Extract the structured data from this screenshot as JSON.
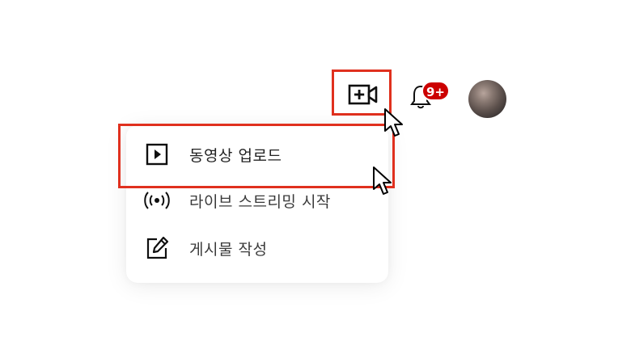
{
  "header": {
    "create_icon": "video-plus-icon",
    "bell_icon": "bell-icon",
    "notification_badge": "9+",
    "avatar": "user-avatar"
  },
  "create_menu": {
    "items": [
      {
        "label": "동영상 업로드",
        "icon": "play-square-icon"
      },
      {
        "label": "라이브 스트리밍 시작",
        "icon": "broadcast-icon"
      },
      {
        "label": "게시물 작성",
        "icon": "edit-post-icon"
      }
    ]
  },
  "annotations": {
    "highlight_color": "#e0301e",
    "badge_color": "#cc0000"
  }
}
